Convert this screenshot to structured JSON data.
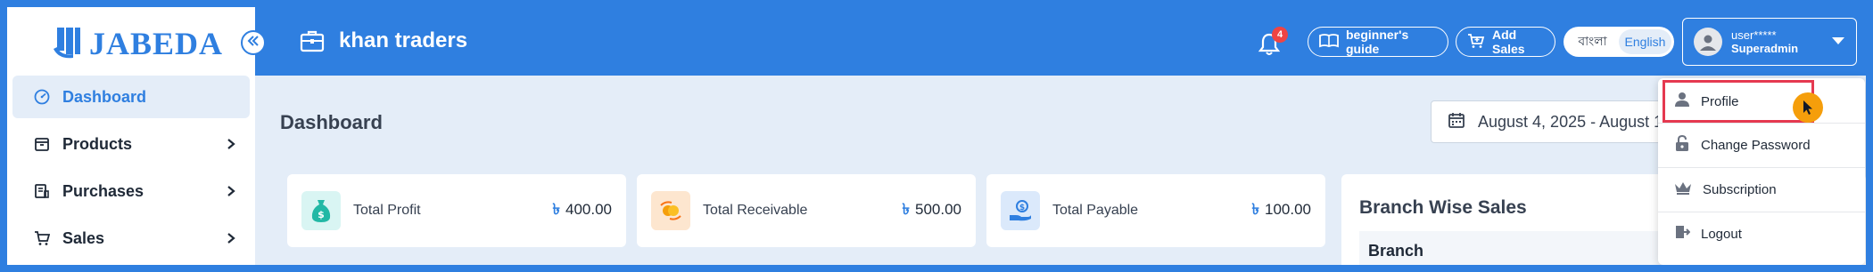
{
  "app": {
    "logo_text": "JABEDA"
  },
  "sidebar": {
    "items": [
      {
        "label": "Dashboard",
        "icon": "gauge-icon",
        "active": true
      },
      {
        "label": "Products",
        "icon": "box-icon",
        "active": false
      },
      {
        "label": "Purchases",
        "icon": "receipt-icon",
        "active": false
      },
      {
        "label": "Sales",
        "icon": "cart-icon",
        "active": false
      }
    ]
  },
  "header": {
    "company_name": "khan traders",
    "notification_count": "4",
    "guide_label": "beginner's guide",
    "add_sales_label": "Add Sales",
    "lang_bangla": "বাংলা",
    "lang_english": "English",
    "user_name": "user*****",
    "user_role": "Superadmin"
  },
  "main": {
    "page_title": "Dashboard",
    "date_range": "August 4, 2025 - August 1",
    "cards": [
      {
        "label": "Total Profit",
        "currency": "৳",
        "value": "400.00",
        "icon": "money-bag-icon",
        "color": "#d9f5f3"
      },
      {
        "label": "Total Receivable",
        "currency": "৳",
        "value": "500.00",
        "icon": "exchange-icon",
        "color": "#fde6cf"
      },
      {
        "label": "Total Payable",
        "currency": "৳",
        "value": "100.00",
        "icon": "hand-coin-icon",
        "color": "#dbe9fb"
      }
    ],
    "branch_sales": {
      "title": "Branch Wise Sales",
      "column_branch": "Branch"
    }
  },
  "dropdown": {
    "items": [
      {
        "label": "Profile",
        "icon": "user-icon"
      },
      {
        "label": "Change Password",
        "icon": "lock-icon"
      },
      {
        "label": "Subscription",
        "icon": "crown-icon"
      },
      {
        "label": "Logout",
        "icon": "logout-icon"
      }
    ]
  },
  "colors": {
    "brand": "#2f7fe0",
    "background": "#e4edf8",
    "highlight": "#e53950",
    "cursor": "#f59e0b"
  }
}
